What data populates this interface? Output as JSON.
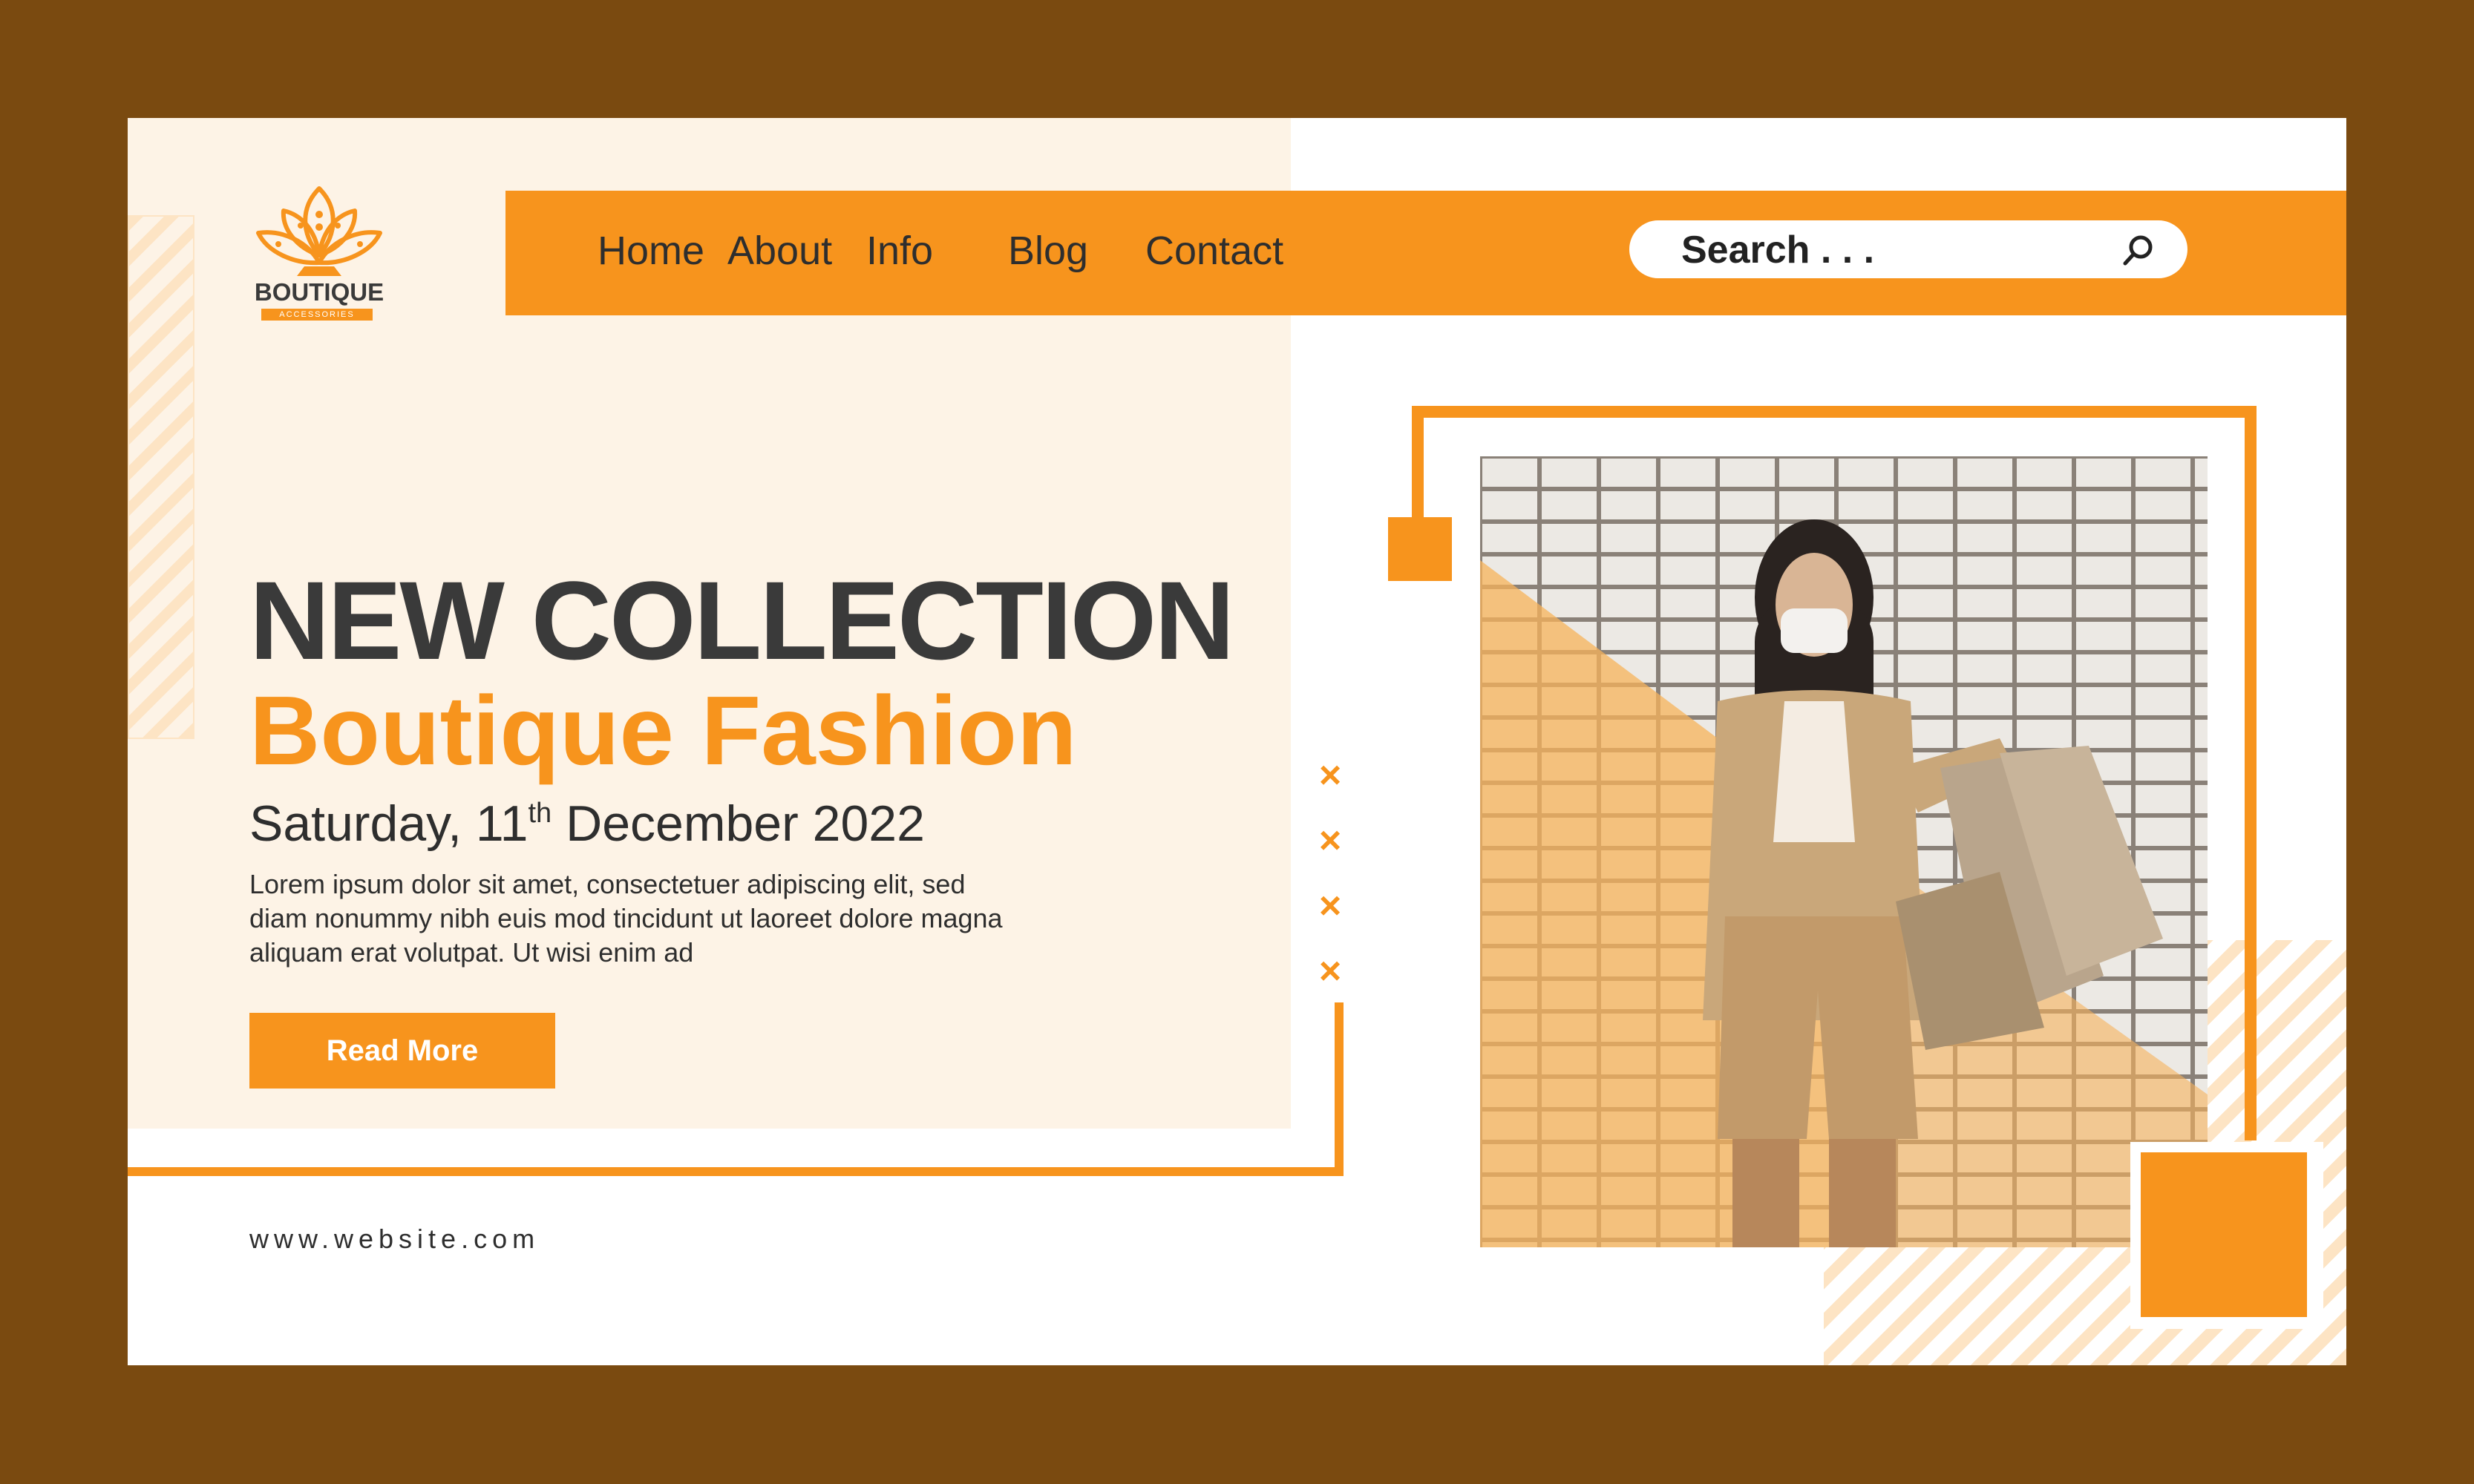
{
  "brand": {
    "name": "BOUTIQUE",
    "tagline": "ACCESSORIES"
  },
  "nav": {
    "items": [
      {
        "label": "Home"
      },
      {
        "label": "About"
      },
      {
        "label": "Info"
      },
      {
        "label": "Blog"
      },
      {
        "label": "Contact"
      }
    ]
  },
  "search": {
    "placeholder": "Search . . ."
  },
  "hero": {
    "headline": "NEW COLLECTION",
    "subheadline": "Boutique Fashion",
    "date_prefix": "Saturday, 11",
    "date_suffix_sup": "th",
    "date_rest": " December 2022",
    "body": "Lorem ipsum dolor sit amet, consectetuer adipiscing elit, sed diam nonummy nibh euis mod tincidunt ut laoreet dolore magna aliquam erat volutpat. Ut wisi enim ad",
    "cta_label": "Read More"
  },
  "footer": {
    "website": "www.website.com"
  },
  "decor": {
    "x_marks": [
      "×",
      "×",
      "×",
      "×"
    ]
  },
  "colors": {
    "accent": "#f7941d",
    "background": "#7a4a10",
    "panel": "#fdf3e6",
    "text_dark": "#3a3a3a"
  }
}
